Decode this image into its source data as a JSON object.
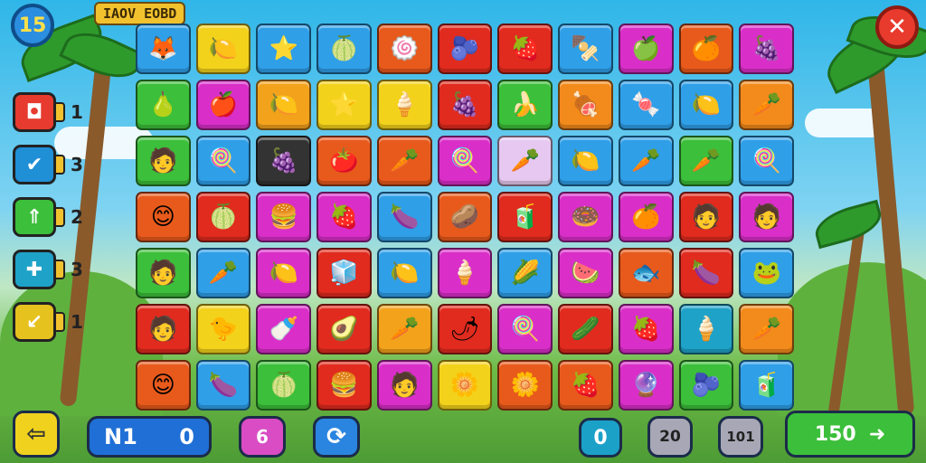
{
  "header": {
    "level_label": "15",
    "title": "IAOV EOBD",
    "close_symbol": "✕"
  },
  "powerups": [
    {
      "name": "bomb",
      "symbol": "◘",
      "color": "#e63b2e",
      "count": "1"
    },
    {
      "name": "check",
      "symbol": "✔",
      "color": "#1f8fd6",
      "count": "3"
    },
    {
      "name": "arrow",
      "symbol": "⇑",
      "color": "#3cbf3a",
      "count": "2"
    },
    {
      "name": "swap",
      "symbol": "✚",
      "color": "#1fa2c8",
      "count": "3"
    },
    {
      "name": "hammer",
      "symbol": "↙",
      "color": "#e6c21e",
      "count": "1"
    }
  ],
  "board": {
    "rows": [
      [
        [
          "#2f9fe8",
          "🦊"
        ],
        [
          "#f3d21c",
          "🍋"
        ],
        [
          "#2f9fe8",
          "⭐"
        ],
        [
          "#2f9fe8",
          "🍈"
        ],
        [
          "#e85a1c",
          "🍥"
        ],
        [
          "#e02b1e",
          "🫐"
        ],
        [
          "#e02b1e",
          "🍓"
        ],
        [
          "#2f9fe8",
          "🍢"
        ],
        [
          "#d92fc8",
          "🍏"
        ],
        [
          "#e85a1c",
          "🍊"
        ],
        [
          "#d92fc8",
          "🍇"
        ]
      ],
      [
        [
          "#3cbf3a",
          "🍐"
        ],
        [
          "#d92fc8",
          "🍎"
        ],
        [
          "#f3a21c",
          "🍋"
        ],
        [
          "#f3d21c",
          "⭐"
        ],
        [
          "#f3d21c",
          "🍦"
        ],
        [
          "#e02b1e",
          "🍇"
        ],
        [
          "#3cbf3a",
          "🍌"
        ],
        [
          "#f38a1c",
          "🍖"
        ],
        [
          "#2f9fe8",
          "🍬"
        ],
        [
          "#2f9fe8",
          "🍋"
        ],
        [
          "#f38a1c",
          "🥕"
        ]
      ],
      [
        [
          "#3cbf3a",
          "🧑"
        ],
        [
          "#2f9fe8",
          "🍭"
        ],
        [
          "#333333",
          "🍇"
        ],
        [
          "#e85a1c",
          "🍅"
        ],
        [
          "#e85a1c",
          "🥕"
        ],
        [
          "#d92fc8",
          "🍭"
        ],
        [
          "#e7c8f0",
          "🥕"
        ],
        [
          "#2f9fe8",
          "🍋"
        ],
        [
          "#2f9fe8",
          "🥕"
        ],
        [
          "#3cbf3a",
          "🥕"
        ],
        [
          "#2f9fe8",
          "🍭"
        ]
      ],
      [
        [
          "#e85a1c",
          "😊"
        ],
        [
          "#e02b1e",
          "🍈"
        ],
        [
          "#d92fc8",
          "🍔"
        ],
        [
          "#d92fc8",
          "🍓"
        ],
        [
          "#2f9fe8",
          "🍆"
        ],
        [
          "#e85a1c",
          "🥔"
        ],
        [
          "#e02b1e",
          "🧃"
        ],
        [
          "#d92fc8",
          "🍩"
        ],
        [
          "#d92fc8",
          "🍊"
        ],
        [
          "#e02b1e",
          "🧑"
        ],
        [
          "#d92fc8",
          "🧑"
        ]
      ],
      [
        [
          "#3cbf3a",
          "🧑"
        ],
        [
          "#2f9fe8",
          "🥕"
        ],
        [
          "#d92fc8",
          "🍋"
        ],
        [
          "#e02b1e",
          "🧊"
        ],
        [
          "#2f9fe8",
          "🍋"
        ],
        [
          "#d92fc8",
          "🍦"
        ],
        [
          "#2f9fe8",
          "🌽"
        ],
        [
          "#d92fc8",
          "🍉"
        ],
        [
          "#e85a1c",
          "🐟"
        ],
        [
          "#e02b1e",
          "🍆"
        ],
        [
          "#2f9fe8",
          "🐸"
        ]
      ],
      [
        [
          "#e02b1e",
          "🧑"
        ],
        [
          "#f3d21c",
          "🐤"
        ],
        [
          "#d92fc8",
          "🍼"
        ],
        [
          "#e02b1e",
          "🥑"
        ],
        [
          "#f3a21c",
          "🥕"
        ],
        [
          "#e02b1e",
          "🌶"
        ],
        [
          "#d92fc8",
          "🍭"
        ],
        [
          "#e02b1e",
          "🥒"
        ],
        [
          "#d92fc8",
          "🍓"
        ],
        [
          "#1fa2c8",
          "🍦"
        ],
        [
          "#f38a1c",
          "🥕"
        ]
      ],
      [
        [
          "#e85a1c",
          "😊"
        ],
        [
          "#2f9fe8",
          "🍆"
        ],
        [
          "#3cbf3a",
          "🍈"
        ],
        [
          "#e02b1e",
          "🍔"
        ],
        [
          "#d92fc8",
          "🧑"
        ],
        [
          "#f3d21c",
          "🌼"
        ],
        [
          "#e85a1c",
          "🌼"
        ],
        [
          "#e85a1c",
          "🍓"
        ],
        [
          "#d92fc8",
          "🔮"
        ],
        [
          "#3cbf3a",
          "🫐"
        ],
        [
          "#2f9fe8",
          "🧃"
        ]
      ]
    ]
  },
  "footer": {
    "back_symbol": "⇦",
    "score_label": "N1",
    "score_value": "0",
    "moves_value": "6",
    "shuffle_symbol": "⟳",
    "hint_value": "0",
    "stat_a": "20",
    "stat_b": "101",
    "next_value": "150",
    "next_symbol": "➜"
  }
}
